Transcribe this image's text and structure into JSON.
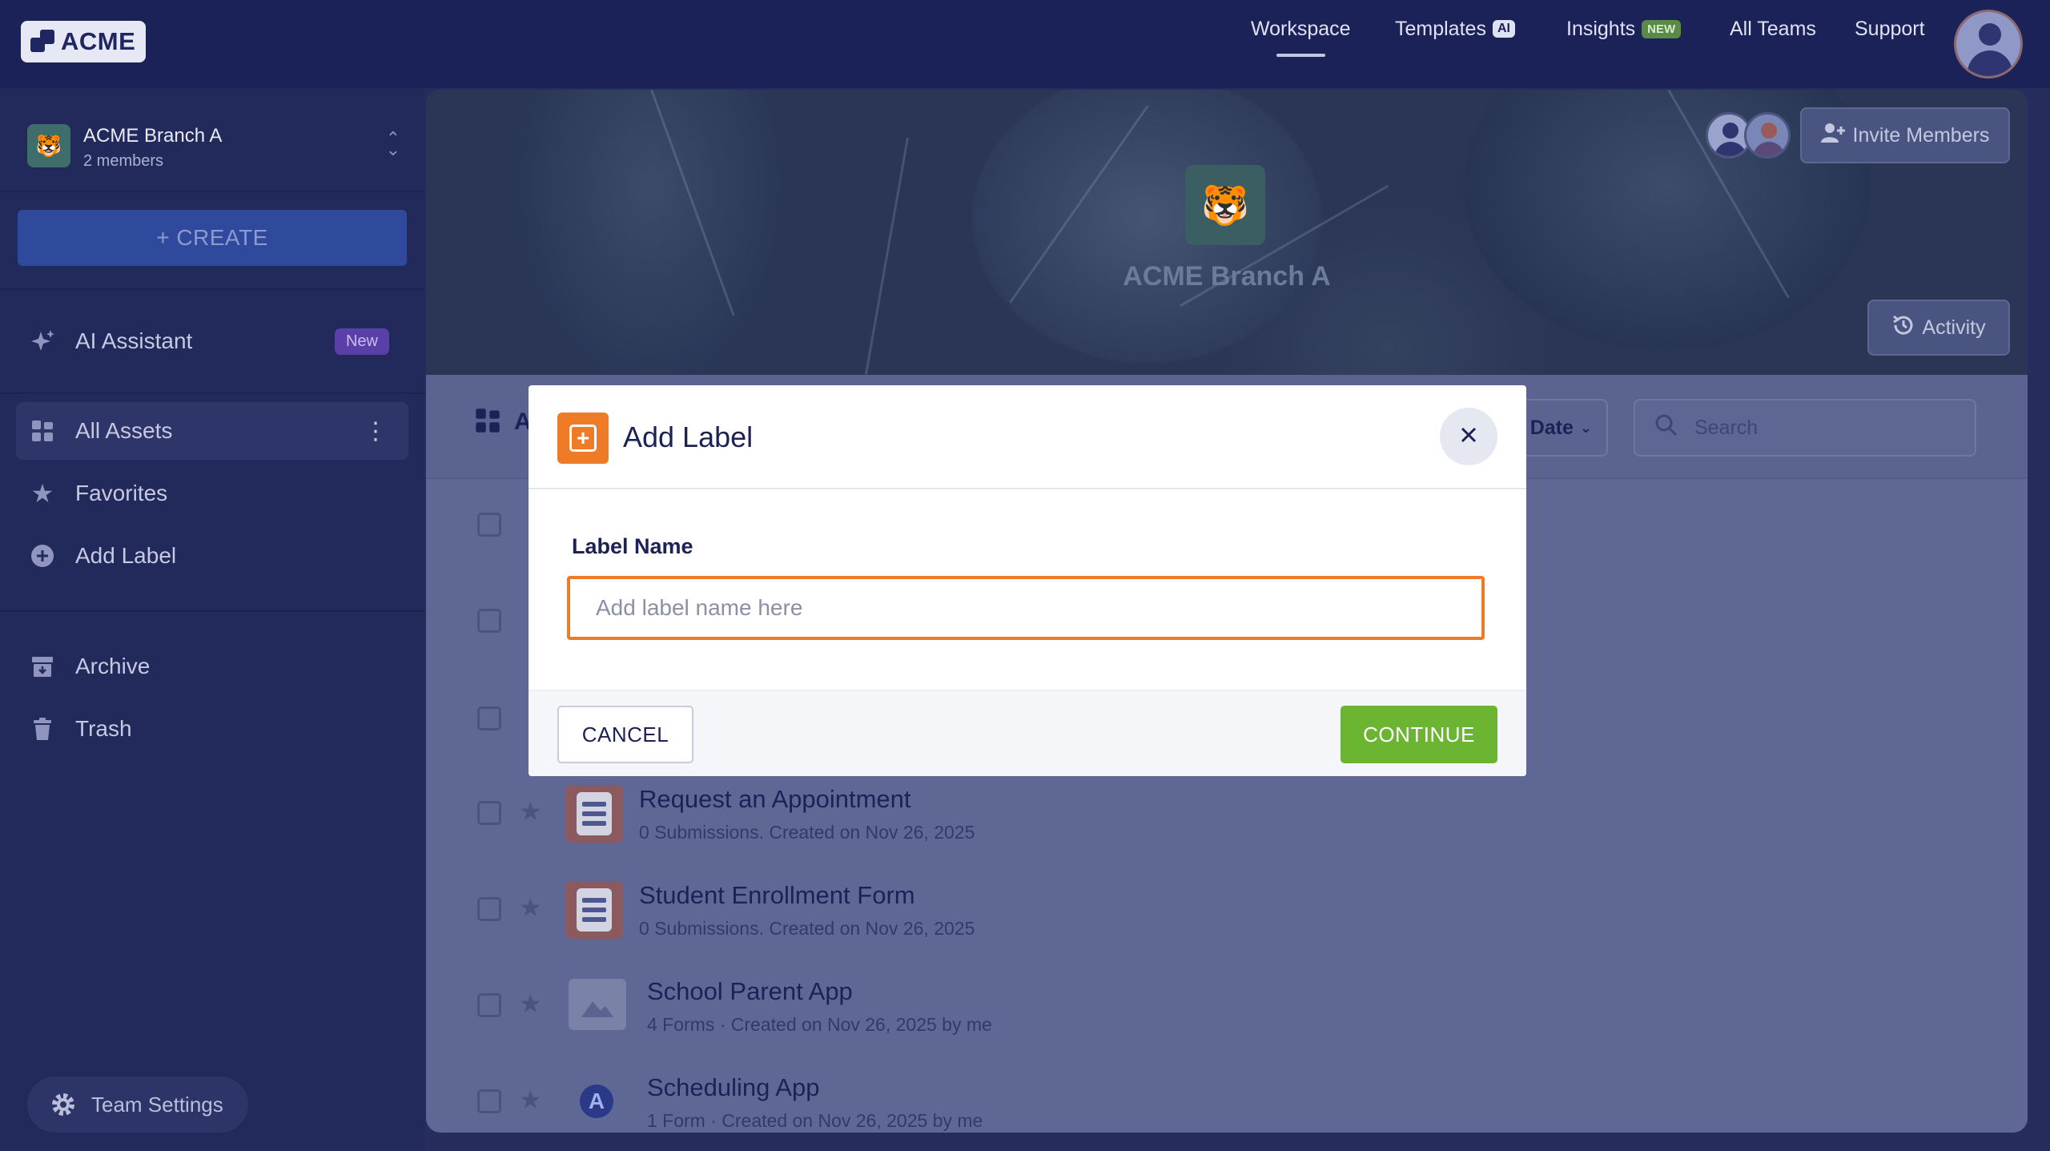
{
  "brand": {
    "logo_text": "ACME"
  },
  "nav": {
    "items": [
      {
        "label": "Workspace",
        "badge": ""
      },
      {
        "label": "Templates",
        "badge": "AI"
      },
      {
        "label": "Insights",
        "badge": "NEW"
      },
      {
        "label": "All Teams",
        "badge": ""
      },
      {
        "label": "Support",
        "badge": ""
      }
    ],
    "active": "Workspace"
  },
  "sidebar": {
    "team": {
      "name": "ACME Branch A",
      "members": "2 members"
    },
    "create_label": "+ CREATE",
    "ai_assistant": {
      "label": "AI Assistant",
      "badge": "New"
    },
    "items": [
      {
        "label": "All Assets",
        "icon": "grid-icon"
      },
      {
        "label": "Favorites",
        "icon": "star-icon"
      },
      {
        "label": "Add Label",
        "icon": "plus-circle-icon"
      },
      {
        "label": "Archive",
        "icon": "archive-icon"
      },
      {
        "label": "Trash",
        "icon": "trash-icon"
      }
    ],
    "team_settings": "Team Settings"
  },
  "hero": {
    "title": "ACME Branch A",
    "invite_label": "Invite Members",
    "activity_label": "Activity"
  },
  "list": {
    "header_fragment": "A",
    "sort_label": "n Date",
    "search_placeholder": "Search",
    "rows": [
      {
        "title": "Request an Appointment",
        "subtitle": "0 Submissions. Created on Nov 26, 2025",
        "kind": "form"
      },
      {
        "title": "Student Enrollment Form",
        "subtitle": "0 Submissions. Created on Nov 26, 2025",
        "kind": "form"
      },
      {
        "title": "School Parent App",
        "subtitle": "4 Forms · Created on Nov 26, 2025 by me",
        "kind": "app-image"
      },
      {
        "title": "Scheduling App",
        "subtitle": "1 Form · Created on Nov 26, 2025 by me",
        "kind": "app-logo"
      }
    ]
  },
  "modal": {
    "title": "Add Label",
    "field_label": "Label Name",
    "field_placeholder": "Add label name here",
    "field_value": "",
    "cancel_label": "CANCEL",
    "continue_label": "CONTINUE"
  },
  "colors": {
    "accent_orange": "#ee7b26",
    "continue_green": "#6cb532",
    "navy": "#1b2258"
  }
}
